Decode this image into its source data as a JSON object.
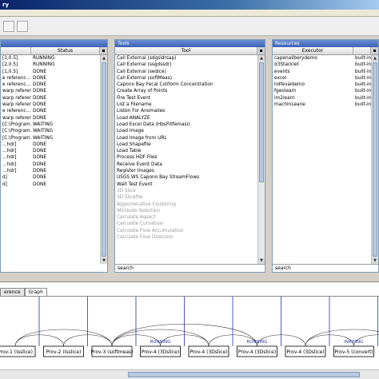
{
  "window": {
    "title": "ry"
  },
  "left_panel": {
    "columns": [
      "Status"
    ],
    "rows": [
      [
        "[1,0.5]",
        "RUNNING"
      ],
      [
        "[2,0.5]",
        "RUNNING"
      ],
      [
        "[1,0.5]",
        "DONE"
      ],
      [
        "e referenc...",
        "DONE"
      ],
      [
        "e referenc...",
        "DONE"
      ],
      [
        "warp referenc...",
        "DONE"
      ],
      [
        "warp referenc...",
        "DONE"
      ],
      [
        "warp referenc...",
        "DONE"
      ],
      [
        "e referenc...",
        "DONE"
      ],
      [
        "warp referenc...",
        "DONE"
      ],
      [
        "[C:\\Program...",
        "WAITING"
      ],
      [
        "[C:\\Program...",
        "WAITING"
      ],
      [
        "[C:\\Program...",
        "WAITING"
      ],
      [
        "...hdr]",
        "DONE"
      ],
      [
        "...hdr]",
        "DONE"
      ],
      [
        "...hdr]",
        "DONE"
      ],
      [
        "...hdr]",
        "DONE"
      ],
      [
        "...hdr]",
        "DONE"
      ],
      [
        "d]",
        "DONE"
      ],
      [
        "d]",
        "DONE"
      ]
    ]
  },
  "tools_panel": {
    "title": "Tools",
    "columns": [
      "Tool"
    ],
    "search_label": "search",
    "items": [
      {
        "label": "Call External (sdgsidrsap)",
        "grey": false
      },
      {
        "label": "Call External (ssgdssdr)",
        "grey": false
      },
      {
        "label": "Call External (sedice)",
        "grey": false
      },
      {
        "label": "Call External (softMeas)",
        "grey": false
      },
      {
        "label": "Capono Bay Fecal Coliform Concentration",
        "grey": false
      },
      {
        "label": "Create Array of Points",
        "grey": false
      },
      {
        "label": "Fire Test Event",
        "grey": false
      },
      {
        "label": "List a Filename",
        "grey": false
      },
      {
        "label": "Listen For Anomalies",
        "grey": false
      },
      {
        "label": "Load ANALYZE",
        "grey": false
      },
      {
        "label": "Load Excel Data (HbsFillfemasi)",
        "grey": false
      },
      {
        "label": "Load Image",
        "grey": false
      },
      {
        "label": "Load Image from URL",
        "grey": false
      },
      {
        "label": "Load Shapefile",
        "grey": false
      },
      {
        "label": "Load Table",
        "grey": false
      },
      {
        "label": "Process HDF Files",
        "grey": false
      },
      {
        "label": "Receive Event Data",
        "grey": false
      },
      {
        "label": "Register Images",
        "grey": false
      },
      {
        "label": "USGS WS Capono Bay StreamFlows",
        "grey": false
      },
      {
        "label": "Wait Test Event",
        "grey": false
      },
      {
        "label": "3D Slice",
        "grey": true
      },
      {
        "label": "3D Slicefile",
        "grey": true
      },
      {
        "label": "Agglomerative Clustering",
        "grey": true
      },
      {
        "label": "Attribute Selection",
        "grey": true
      },
      {
        "label": "Calculate Aspect",
        "grey": true
      },
      {
        "label": "Calculate Curvature",
        "grey": true
      },
      {
        "label": "Calculate Flow Accumulation",
        "grey": true
      },
      {
        "label": "Calculate Flow Direction",
        "grey": true
      }
    ]
  },
  "resources_panel": {
    "title": "Resources",
    "columns": [
      "Executor"
    ],
    "search_label": "search",
    "rows": [
      [
        "capenaliberydemo",
        "built-in"
      ],
      [
        "d3Stacklet",
        "built-in"
      ],
      [
        "events",
        "built-in"
      ],
      [
        "excel",
        "built-in"
      ],
      [
        "hdfevaldemo",
        "built-in"
      ],
      [
        "fgeolearn",
        "built-in"
      ],
      [
        "im2learn",
        "built-in"
      ],
      [
        "machinLeane",
        "built-in"
      ]
    ]
  },
  "bottom_tabs": [
    "erence",
    "Graph"
  ],
  "graph": {
    "status_labels": [
      "RUNNING",
      "RUNNING",
      "WAITING"
    ],
    "nodes": [
      "Prov-1 (Isslice)",
      "Prov-2 (Isslice)",
      "Prov-3 (softmeas)",
      "Prov-4 (3Dslice)",
      "Prov-4 (3Dslice)",
      "Prov-4 (3Dslice)",
      "Prov-4 (3Dslice)",
      "Prov-5 (convert)",
      "Prov-6 (convert)"
    ]
  },
  "colors": {
    "panel_border": "#7f9db9",
    "title_gradient": "#3b62b8",
    "link_blue": "#2a3aa8"
  }
}
